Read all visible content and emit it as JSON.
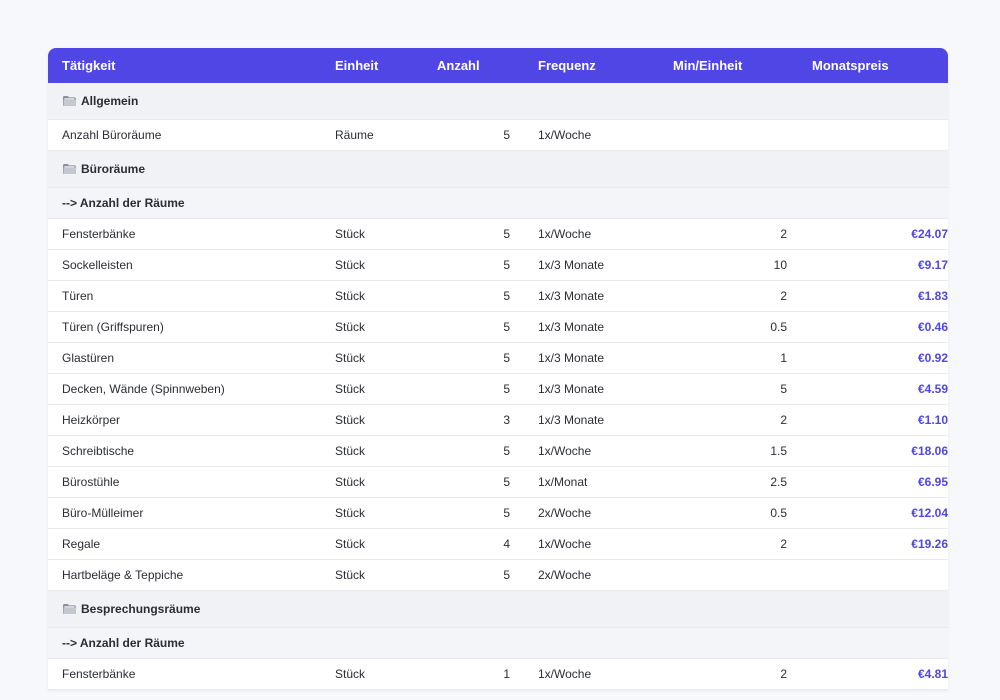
{
  "columns": {
    "task": "Tätigkeit",
    "unit": "Einheit",
    "qty": "Anzahl",
    "freq": "Frequenz",
    "min": "Min/Einheit",
    "price": "Monatspreis"
  },
  "colors": {
    "header_bg": "#4f46e5",
    "price_text": "#4f46e5"
  },
  "rows": [
    {
      "type": "section",
      "icon": "folder-icon",
      "label": "Allgemein"
    },
    {
      "type": "item",
      "task": "Anzahl Büroräume",
      "unit": "Räume",
      "qty": "5",
      "freq": "1x/Woche",
      "min": "",
      "price": ""
    },
    {
      "type": "section",
      "icon": "folder-icon",
      "label": "Büroräume"
    },
    {
      "type": "subsection",
      "label": "--> Anzahl der Räume"
    },
    {
      "type": "item",
      "task": "Fensterbänke",
      "unit": "Stück",
      "qty": "5",
      "freq": "1x/Woche",
      "min": "2",
      "price": "€24.07"
    },
    {
      "type": "item",
      "task": "Sockelleisten",
      "unit": "Stück",
      "qty": "5",
      "freq": "1x/3 Monate",
      "min": "10",
      "price": "€9.17"
    },
    {
      "type": "item",
      "task": "Türen",
      "unit": "Stück",
      "qty": "5",
      "freq": "1x/3 Monate",
      "min": "2",
      "price": "€1.83"
    },
    {
      "type": "item",
      "task": "Türen (Griffspuren)",
      "unit": "Stück",
      "qty": "5",
      "freq": "1x/3 Monate",
      "min": "0.5",
      "price": "€0.46"
    },
    {
      "type": "item",
      "task": "Glastüren",
      "unit": "Stück",
      "qty": "5",
      "freq": "1x/3 Monate",
      "min": "1",
      "price": "€0.92"
    },
    {
      "type": "item",
      "task": "Decken, Wände (Spinnweben)",
      "unit": "Stück",
      "qty": "5",
      "freq": "1x/3 Monate",
      "min": "5",
      "price": "€4.59"
    },
    {
      "type": "item",
      "task": "Heizkörper",
      "unit": "Stück",
      "qty": "3",
      "freq": "1x/3 Monate",
      "min": "2",
      "price": "€1.10"
    },
    {
      "type": "item",
      "task": "Schreibtische",
      "unit": "Stück",
      "qty": "5",
      "freq": "1x/Woche",
      "min": "1.5",
      "price": "€18.06"
    },
    {
      "type": "item",
      "task": "Bürostühle",
      "unit": "Stück",
      "qty": "5",
      "freq": "1x/Monat",
      "min": "2.5",
      "price": "€6.95"
    },
    {
      "type": "item",
      "task": "Büro-Mülleimer",
      "unit": "Stück",
      "qty": "5",
      "freq": "2x/Woche",
      "min": "0.5",
      "price": "€12.04"
    },
    {
      "type": "item",
      "task": "Regale",
      "unit": "Stück",
      "qty": "4",
      "freq": "1x/Woche",
      "min": "2",
      "price": "€19.26"
    },
    {
      "type": "item",
      "task": "Hartbeläge & Teppiche",
      "unit": "Stück",
      "qty": "5",
      "freq": "2x/Woche",
      "min": "",
      "price": ""
    },
    {
      "type": "section",
      "icon": "folder-icon",
      "label": "Besprechungsräume"
    },
    {
      "type": "subsection",
      "label": "--> Anzahl der Räume"
    },
    {
      "type": "item",
      "task": "Fensterbänke",
      "unit": "Stück",
      "qty": "1",
      "freq": "1x/Woche",
      "min": "2",
      "price": "€4.81"
    }
  ]
}
